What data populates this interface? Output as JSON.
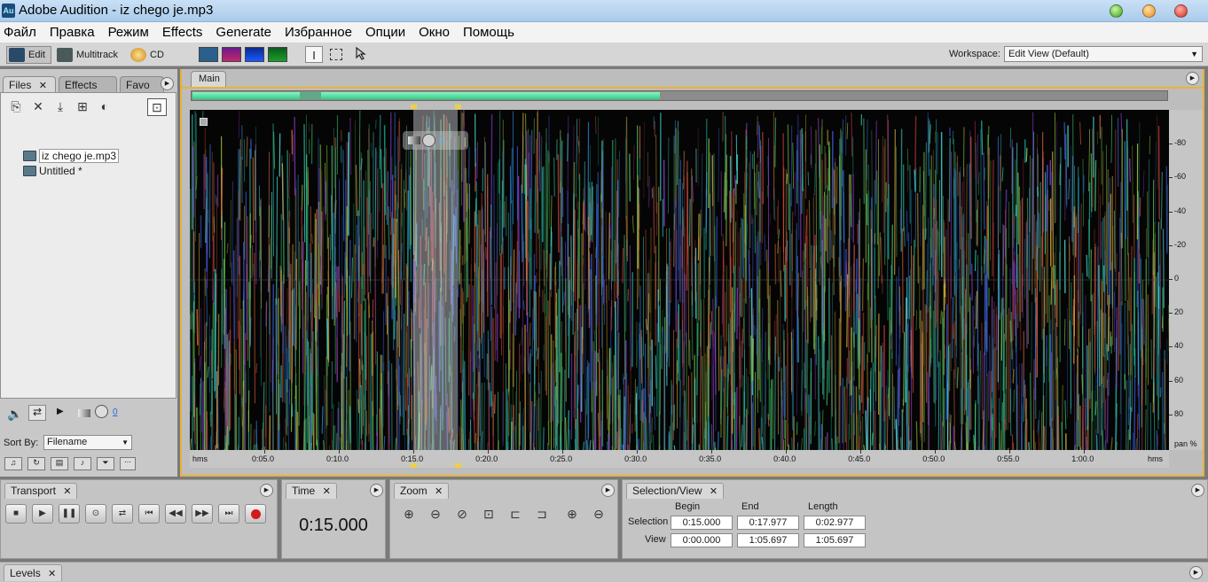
{
  "window": {
    "app_icon": "Au",
    "title": "Adobe Audition - iz chego je.mp3"
  },
  "menu": [
    "Файл",
    "Правка",
    "Режим",
    "Effects",
    "Generate",
    "Избранное",
    "Опции",
    "Окно",
    "Помощь"
  ],
  "toolbar": {
    "views": {
      "edit": "Edit",
      "multitrack": "Multitrack",
      "cd": "CD"
    },
    "tools": {
      "time_selection": "I"
    },
    "workspace_label": "Workspace:",
    "workspace_value": "Edit View (Default)"
  },
  "files_panel": {
    "tabs": {
      "files": "Files",
      "effects": "Effects",
      "favorites": "Favo"
    },
    "files": [
      {
        "name": "iz chego je.mp3",
        "selected": true
      },
      {
        "name": "Untitled *",
        "selected": false
      }
    ],
    "volume_value": "0",
    "sort_by_label": "Sort By:",
    "sort_by_value": "Filename"
  },
  "main_panel": {
    "tab": "Main",
    "view_mode": "pan",
    "volume_overlay_value": "0",
    "overview": {
      "visible_fraction": 0.48,
      "position_fraction": 0.11
    },
    "selection": {
      "begin_s": 15.0,
      "end_s": 17.977
    },
    "duration_s": 65.697,
    "x_axis": {
      "start_label": "hms",
      "end_label": "hms",
      "ticks": [
        "0:05.0",
        "0:10.0",
        "0:15.0",
        "0:20.0",
        "0:25.0",
        "0:30.0",
        "0:35.0",
        "0:40.0",
        "0:45.0",
        "0:50.0",
        "0:55.0",
        "1:00.0"
      ]
    },
    "y_axis": {
      "ticks": [
        "-80",
        "-60",
        "-40",
        "-20",
        "0",
        "20",
        "40",
        "60",
        "80"
      ],
      "unit_label": "pan %"
    }
  },
  "transport": {
    "tab": "Transport",
    "buttons": [
      "stop-icon",
      "play-icon",
      "pause-icon",
      "play-from-cursor-icon",
      "loop-icon",
      "go-to-start-icon",
      "rewind-icon",
      "fast-forward-icon",
      "go-to-end-icon",
      "record-icon"
    ],
    "record_color": "#d21a1a"
  },
  "time_panel": {
    "tab": "Time",
    "value": "0:15.000"
  },
  "zoom_panel": {
    "tab": "Zoom"
  },
  "selection_view": {
    "tab": "Selection/View",
    "headers": {
      "begin": "Begin",
      "end": "End",
      "length": "Length"
    },
    "selection": {
      "label": "Selection",
      "begin": "0:15.000",
      "end": "0:17.977",
      "length": "0:02.977"
    },
    "view": {
      "label": "View",
      "begin": "0:00.000",
      "end": "1:05.697",
      "length": "1:05.697"
    }
  },
  "levels_panel": {
    "tab": "Levels"
  },
  "colors": {
    "accent_frame": "#e8b23a",
    "overview_fill": "#2fcf86",
    "selection_marker": "#f0d040"
  }
}
